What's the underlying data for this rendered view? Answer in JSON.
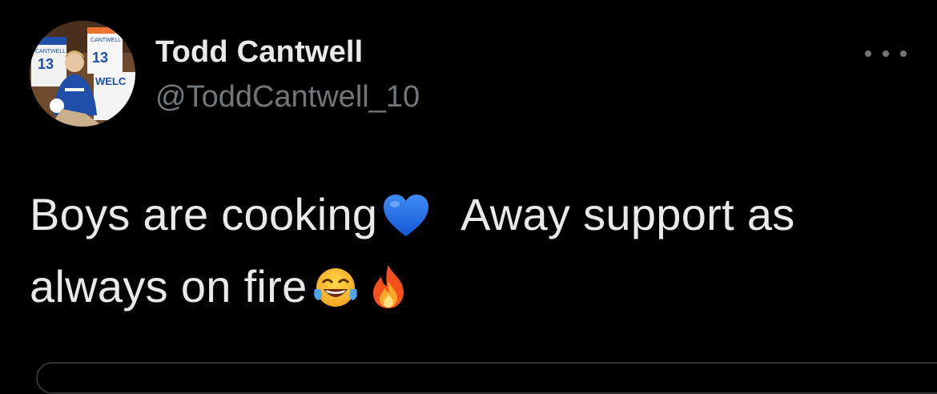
{
  "tweet": {
    "author_name": "Todd Cantwell",
    "author_handle": "@ToddCantwell_10",
    "text_part1": "Boys are cooking",
    "text_part2": "Away support as",
    "text_part3": "always on fire",
    "emojis": [
      "blue-heart-icon",
      "tears-of-joy-icon",
      "fire-icon"
    ],
    "avatar_text": {
      "shirt_name_left": "CANTWELL",
      "shirt_number_left": "13",
      "shirt_name_right": "CANTWELL",
      "shirt_number_right": "13",
      "banner_text": "WELC"
    }
  },
  "colors": {
    "background": "#000000",
    "text_primary": "#e7e9ea",
    "text_secondary": "#71767b",
    "blue_heart": "#1d6fe8"
  }
}
